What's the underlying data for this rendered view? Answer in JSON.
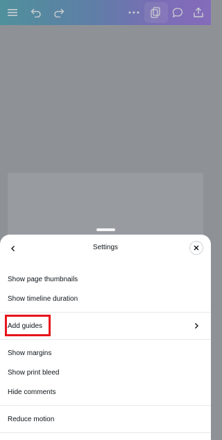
{
  "toolbar": {
    "icons": [
      "menu-icon",
      "undo-icon",
      "redo-icon",
      "more-icon",
      "pages-icon",
      "comment-icon",
      "share-icon"
    ]
  },
  "sheet": {
    "title": "Settings",
    "items_group1": [
      {
        "label": "Show page thumbnails"
      },
      {
        "label": "Show timeline duration"
      }
    ],
    "add_guides": {
      "label": "Add guides"
    },
    "items_group3": [
      {
        "label": "Show margins"
      },
      {
        "label": "Show print bleed"
      },
      {
        "label": "Hide comments"
      }
    ],
    "items_group4": [
      {
        "label": "Reduce motion"
      }
    ]
  },
  "colors": {
    "highlight": "#e8141b",
    "canvas_bg": "#8e9297"
  }
}
